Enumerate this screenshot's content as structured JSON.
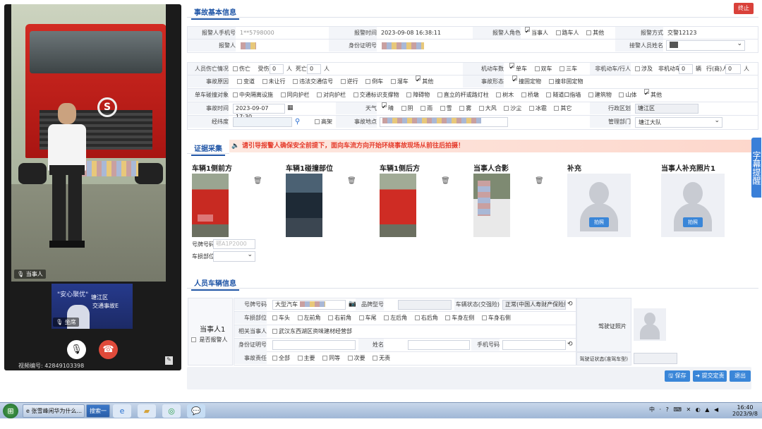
{
  "video": {
    "person_label": "当事人",
    "pip_label": "坐席",
    "pip_text1": "\"安心聚优\"",
    "pip_text2": "塘江区",
    "pip_text3": "交通事故E",
    "video_number_label": "视频编号:",
    "video_number": "42849103398"
  },
  "header": {
    "section_basic": "事故基本信息",
    "stop_button": "终止"
  },
  "basic": {
    "reporter_phone_label": "报警人手机号",
    "reporter_phone": "1**5798000",
    "report_time_label": "报警时间",
    "report_time": "2023-09-08 16:38:11",
    "reporter_role_label": "报警人角色",
    "roles": [
      "当事人",
      "路车人",
      "其他"
    ],
    "report_method_label": "报警方式",
    "report_method": "交警12123",
    "reporter_label": "报警人",
    "id_label": "身份证明号",
    "receiver_label": "接警人员姓名"
  },
  "accident": {
    "casualty_label": "人员伤亡情况",
    "casualty_none": "伤亡",
    "injured_label": "受伤",
    "injured": "0",
    "dead_label": "死亡",
    "dead": "0",
    "person_unit": "人",
    "vehicle_count_label": "机动车数",
    "vehicle_counts": [
      "单车",
      "双车",
      "三车"
    ],
    "nonmotor_label": "非机动车/行人",
    "involve": "涉及",
    "nonmotor_count_label": "非机动车",
    "nonmotor_count": "0",
    "unit_vehicle": "辆",
    "pedestrian_label": "行(商)人",
    "pedestrian_count": "0",
    "cause_label": "事故原因",
    "causes": [
      "变道",
      "未让行",
      "违法交通信号",
      "逆行",
      "倒车",
      "溜车",
      "其他"
    ],
    "form_label": "事故形态",
    "forms": [
      "撞固定物",
      "撞非固定物"
    ],
    "single_obj_label": "单车碰撞对象",
    "single_objs": [
      "中央隔离设施",
      "同向护栏",
      "对向护栏",
      "交通标识支撑物",
      "障碍物",
      "直立的杆或路灯柱",
      "树木",
      "桥墩",
      "隧道口指墙",
      "建筑物",
      "山体",
      "其他"
    ],
    "time_label": "事故时间",
    "time": "2023-09-07 17:30",
    "weather_label": "天气",
    "weathers": [
      "晴",
      "阴",
      "雨",
      "雪",
      "雾",
      "大风",
      "沙尘",
      "冰雹",
      "其它"
    ],
    "district_label": "行政区划",
    "district": "塘江区",
    "latlng_label": "经纬度",
    "highway": "高架",
    "place_label": "事故地点",
    "dept_label": "管理部门",
    "dept": "塘江大队"
  },
  "evidence": {
    "title": "证据采集",
    "notice": "请引导报警人确保安全前提下，面向车流方向开始环绕事故现场从前往后拍摄！",
    "photos": [
      "车辆1侧前方",
      "车辆1碰撞部位",
      "车辆1侧后方",
      "当事人合影",
      "补充",
      "当事人补充照片1"
    ],
    "shoot_label": "拍照",
    "plate_label": "号牌号码",
    "plate": "鄂A1P2000",
    "collision_label": "车损部位"
  },
  "side_tab": "字幕提醒",
  "person": {
    "section": "人员车辆信息",
    "party": "当事人1",
    "is_reporter": "是否报警人",
    "plate_label": "号牌号码",
    "plate_type": "大型汽车",
    "brand_label": "品牌型号",
    "status_label": "车辆状态(交强险)",
    "status": "正常(中国人寿财产保险股份",
    "damage_label": "车损部位",
    "damages": [
      "车头",
      "左前角",
      "右前角",
      "车尾",
      "左后角",
      "右后角",
      "车身左侧",
      "车身右侧"
    ],
    "rel_party_label": "相关当事人",
    "rel_party": "武汉东西湖区资味建材经营部",
    "id_label": "身份证明号码",
    "name_label": "姓名",
    "phone_label": "手机号码",
    "resp_label": "事故责任",
    "resps": [
      "全部",
      "主要",
      "同等",
      "次要",
      "无责"
    ],
    "license_photo_label": "驾驶证照片",
    "license_status_label": "驾驶证状态(准驾车型)"
  },
  "actions": {
    "save": "保存",
    "submit": "提交定责",
    "exit": "退出"
  },
  "taskbar": {
    "task1": "张雪峰闲华为什么...",
    "search": "搜索一下",
    "time": "16:40",
    "date": "2023/9/8",
    "tray": "中 · ? ⌨ ✕ ◐ ▲ ◀"
  }
}
